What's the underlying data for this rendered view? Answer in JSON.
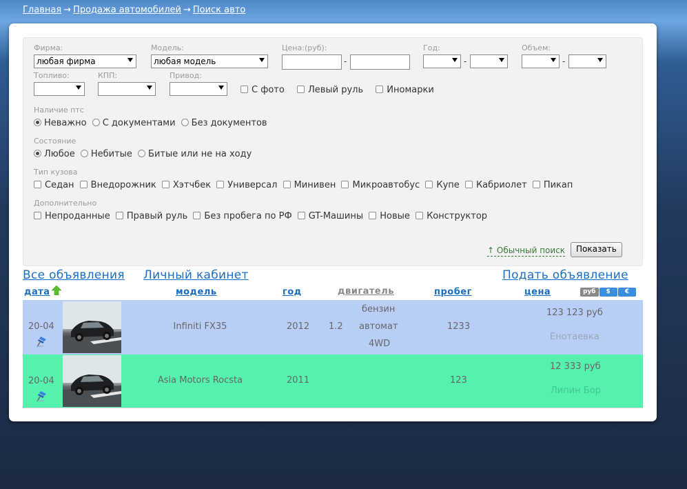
{
  "breadcrumb": [
    "Главная",
    "Продажа автомобилей",
    "Поиск авто"
  ],
  "breadcrumb_sep": "→",
  "filters": {
    "brand_label": "Фирма:",
    "brand_value": "любая фирма",
    "model_label": "Модель:",
    "model_value": "любая модель",
    "price_label": "Цена:(руб):",
    "year_label": "Год:",
    "volume_label": "Объем:",
    "dash": "-",
    "fuel_label": "Топливо:",
    "gearbox_label": "КПП:",
    "drive_label": "Привод:",
    "with_photo": "С фото",
    "left_wheel": "Левый руль",
    "foreign": "Иномарки",
    "pts_label": "Наличие птс",
    "pts_any": "Неважно",
    "pts_docs": "С документами",
    "pts_nodocs": "Без документов",
    "state_label": "Состояние",
    "state_any": "Любое",
    "state_unbroken": "Небитые",
    "state_broken": "Битые или не на ходу",
    "body_label": "Тип кузова",
    "body_types": [
      "Седан",
      "Внедорожник",
      "Хэтчбек",
      "Универсал",
      "Минивен",
      "Микроавтобус",
      "Купе",
      "Кабриолет",
      "Пикап"
    ],
    "extra_label": "Дополнительно",
    "extras": [
      "Непроданные",
      "Правый руль",
      "Без пробега по РФ",
      "GT-Машины",
      "Новые",
      "Конструктор"
    ],
    "normal_search": "↑ Обычный поиск",
    "show_button": "Показать"
  },
  "links": {
    "all_ads": "Все объявления",
    "cabinet": "Личный кабинет",
    "post_ad": "Подать объявление"
  },
  "columns": {
    "date": "дата",
    "model": "модель",
    "year": "год",
    "engine": "двигатель",
    "mileage": "пробег",
    "price": "цена"
  },
  "currencies": [
    "руб",
    "$",
    "€"
  ],
  "colors": {
    "row1": "#b9cef7",
    "row2": "#55f2ad",
    "link": "#1a6fc4",
    "cur_rub": "#888888",
    "cur_usd": "#3b8de0",
    "cur_eur": "#3b8de0"
  },
  "listings": [
    {
      "date": "20-04",
      "model": "Infiniti FX35",
      "year": "2012",
      "volume": "1.2",
      "fuel": "бензин",
      "gearbox": "автомат",
      "drive": "4WD",
      "mileage": "1233",
      "price": "123 123 руб",
      "city": "Енотаевка"
    },
    {
      "date": "20-04",
      "model": "Asia Motors Rocsta",
      "year": "2011",
      "mileage": "123",
      "price": "12 333 руб",
      "city": "Липин Бор"
    }
  ]
}
